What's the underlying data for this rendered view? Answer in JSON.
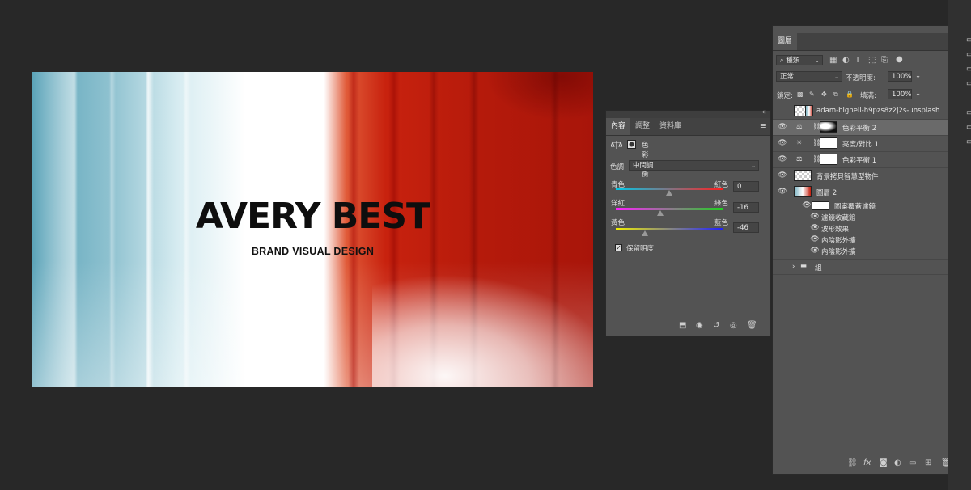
{
  "canvas": {
    "title": "AVERY BEST",
    "subtitle": "BRAND VISUAL DESIGN"
  },
  "properties_panel": {
    "tabs": [
      {
        "label": "內容",
        "active": true
      },
      {
        "label": "調整",
        "active": false
      },
      {
        "label": "資料庫",
        "active": false
      }
    ],
    "adjustment_name": "色彩平衡",
    "tone_label": "色調:",
    "tone_value": "中間調",
    "sliders": [
      {
        "left_label": "青色",
        "right_label": "紅色",
        "value": "0",
        "level_fraction": 0.5,
        "track": "cyan-red"
      },
      {
        "left_label": "洋紅",
        "right_label": "綠色",
        "value": "-16",
        "level_fraction": 0.42,
        "track": "magenta-green"
      },
      {
        "left_label": "黃色",
        "right_label": "藍色",
        "value": "-46",
        "level_fraction": 0.27,
        "track": "yellow-blue"
      }
    ],
    "preserve_label": "保留明度",
    "preserve_checked": true
  },
  "layers_panel": {
    "tab_label": "圖層",
    "filter_label": "種類",
    "blend_mode": "正常",
    "opacity_label": "不透明度:",
    "opacity_value": "100%",
    "lock_label": "鎖定:",
    "fill_label": "填滿:",
    "fill_value": "100%",
    "layers": [
      {
        "name": "adam-bignell-h9pzs8z2j2s-unsplash",
        "visible": false,
        "selected": false,
        "kind": "image"
      },
      {
        "name": "色彩平衡 2",
        "visible": true,
        "selected": true,
        "kind": "adjustment-color-balance"
      },
      {
        "name": "亮度/對比 1",
        "visible": true,
        "selected": false,
        "kind": "adjustment-brightness"
      },
      {
        "name": "色彩平衡 1",
        "visible": true,
        "selected": false,
        "kind": "adjustment-color-balance"
      },
      {
        "name": "背景拷貝智慧型物件",
        "visible": true,
        "selected": false,
        "kind": "smart-object"
      },
      {
        "name": "圖層 2",
        "visible": true,
        "selected": false,
        "kind": "image-with-effects"
      }
    ],
    "effects": [
      {
        "name": "圖案覆蓋濾鏡",
        "kind": "filter-mask"
      },
      {
        "name": "濾鏡收藏館"
      },
      {
        "name": "波形效果"
      },
      {
        "name": "內陰影外擴"
      },
      {
        "name": "內陰影外擴"
      }
    ],
    "group_name": "組"
  },
  "colors": {
    "app_bg": "#282828",
    "panel_bg": "#535353",
    "selected_row": "#6a6a6a"
  }
}
